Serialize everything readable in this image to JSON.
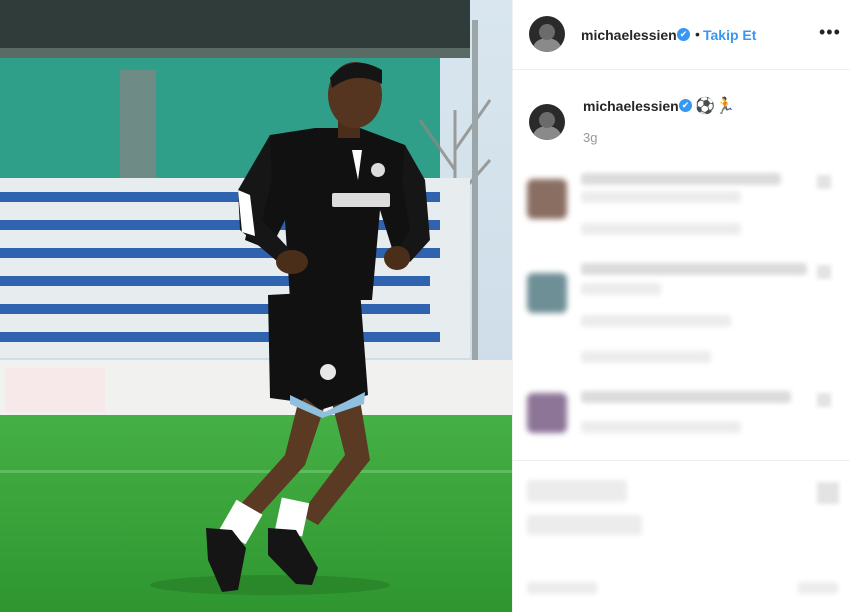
{
  "post": {
    "username": "michaelessien",
    "verified_symbol": "✔",
    "separator": "•",
    "follow_label": "Takip Et",
    "more_symbol": "•••"
  },
  "caption": {
    "username": "michaelessien",
    "verified_symbol": "✔",
    "emoji_1": "⚽",
    "emoji_2": "🏃",
    "time": "3g"
  },
  "colors": {
    "accent": "#3897f0",
    "pitch": "#3aa33a",
    "kit": "#111111"
  }
}
